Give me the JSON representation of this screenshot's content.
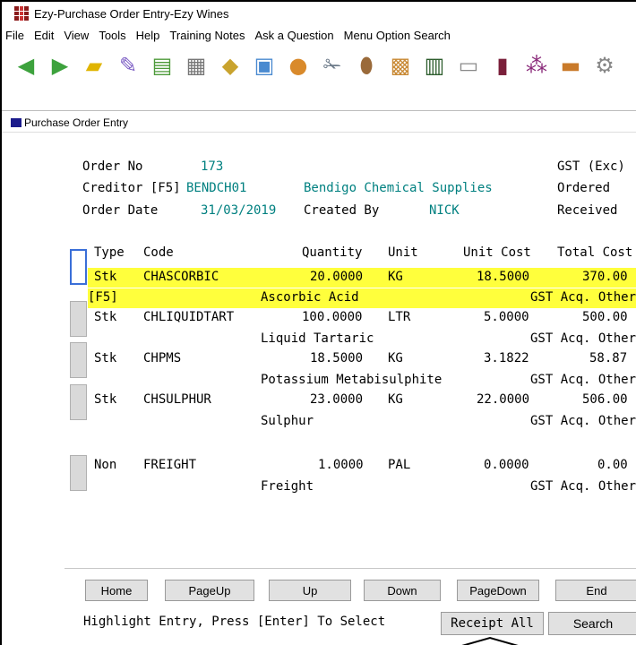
{
  "window": {
    "title": "Ezy-Purchase Order Entry-Ezy Wines"
  },
  "menu": [
    "File",
    "Edit",
    "View",
    "Tools",
    "Help",
    "Training Notes",
    "Ask a Question",
    "Menu Option Search"
  ],
  "toolbar_icons": [
    "back-arrow-icon",
    "forward-arrow-icon",
    "folder-icon",
    "pen-icon",
    "money-icon",
    "building-icon",
    "tag-icon",
    "screen-icon",
    "people-icon",
    "wrench-icon",
    "barrel-icon",
    "box-icon",
    "card-icon",
    "computer-icon",
    "wine-bottle-icon",
    "grapes-icon",
    "briefcase-icon",
    "gear-icon"
  ],
  "form": {
    "subtitle": "Purchase Order Entry",
    "order_no_label": "Order No",
    "order_no": "173",
    "creditor_label": "Creditor [F5]",
    "creditor_code": "BENDCH01",
    "creditor_name": "Bendigo Chemical Supplies",
    "order_date_label": "Order Date",
    "order_date": "31/03/2019",
    "created_by_label": "Created By",
    "created_by": "NICK",
    "gst_label": "GST (Exc)",
    "ordered_label": "Ordered",
    "received_label": "Received"
  },
  "columns": {
    "type": "Type",
    "code": "Code",
    "quantity": "Quantity",
    "unit": "Unit",
    "unit_cost": "Unit Cost",
    "total_cost": "Total Cost"
  },
  "lines": [
    {
      "type": "Stk",
      "code": "CHASCORBIC",
      "quantity": "20.0000",
      "unit": "KG",
      "unit_cost": "18.5000",
      "total_cost": "370.00",
      "prefix": "[F5]",
      "description": "Ascorbic Acid",
      "gst": "GST Acq. Other",
      "highlighted": true
    },
    {
      "type": "Stk",
      "code": "CHLIQUIDTART",
      "quantity": "100.0000",
      "unit": "LTR",
      "unit_cost": "5.0000",
      "total_cost": "500.00",
      "prefix": "",
      "description": "Liquid Tartaric",
      "gst": "GST Acq. Other",
      "highlighted": false
    },
    {
      "type": "Stk",
      "code": "CHPMS",
      "quantity": "18.5000",
      "unit": "KG",
      "unit_cost": "3.1822",
      "total_cost": "58.87",
      "prefix": "",
      "description": "Potassium Metabisulphite",
      "gst": "GST Acq. Other",
      "highlighted": false
    },
    {
      "type": "Stk",
      "code": "CHSULPHUR",
      "quantity": "23.0000",
      "unit": "KG",
      "unit_cost": "22.0000",
      "total_cost": "506.00",
      "prefix": "",
      "description": "Sulphur",
      "gst": "GST Acq. Other",
      "highlighted": false
    },
    {
      "type": "Non",
      "code": "FREIGHT",
      "quantity": "1.0000",
      "unit": "PAL",
      "unit_cost": "0.0000",
      "total_cost": "0.00",
      "prefix": "",
      "description": "Freight",
      "gst": "GST Acq. Other",
      "highlighted": false
    }
  ],
  "nav": {
    "home": "Home",
    "pageup": "PageUp",
    "up": "Up",
    "down": "Down",
    "pagedown": "PageDown",
    "end": "End",
    "hint": "Highlight Entry, Press [Enter] To Select",
    "receipt_all": "Receipt All",
    "search": "Search"
  }
}
